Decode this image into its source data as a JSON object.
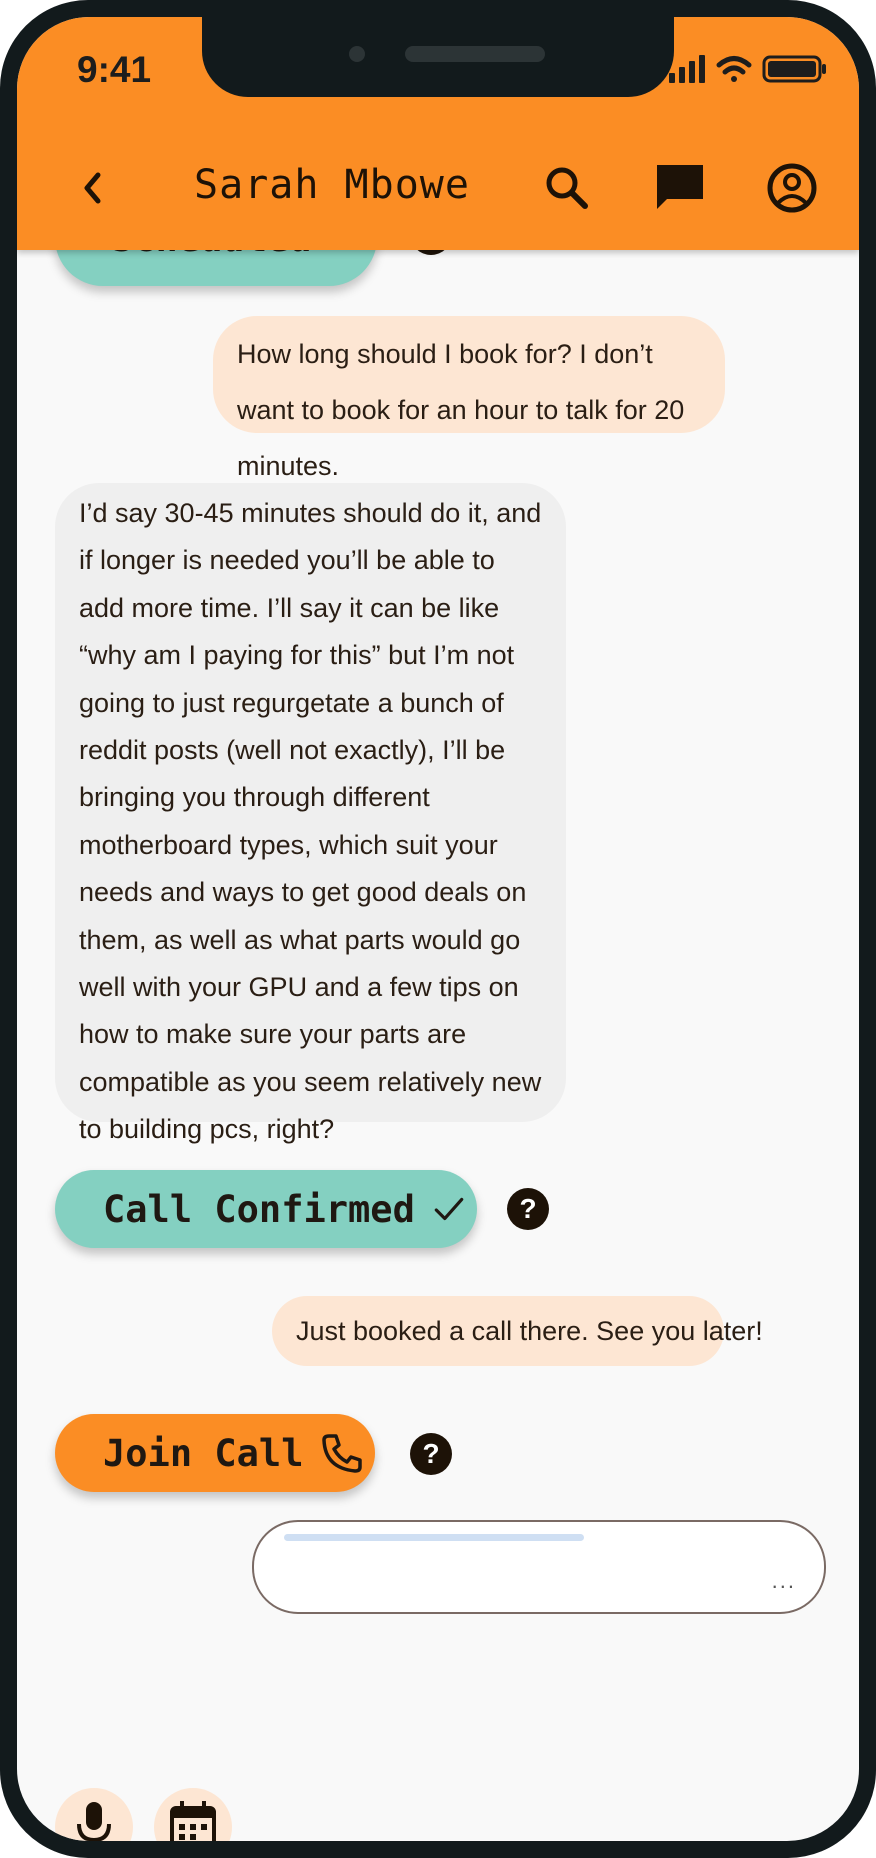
{
  "status_bar": {
    "time": "9:41"
  },
  "header": {
    "title": "Sarah Mbowe"
  },
  "messages": {
    "partial_pill": "Scheduled",
    "out_1": "How long should I book for? I don’t want to book for an hour to talk for 20 minutes.",
    "in_1": "I’d say 30-45 minutes should do it, and if longer is needed you’ll be able to add more time. I’ll say it can be like “why am I paying for this” but I’m not going to just regurgetate a bunch of reddit posts (well not exactly), I’ll be bringing you through different motherboard types, which suit your needs and ways to get good deals on them, as well as what parts would go well with your GPU and a few tips on how to make sure your parts are compatible as you seem relatively new to building pcs, right?",
    "call_confirmed": "Call Confirmed",
    "out_2": "Just booked a call there. See you later!",
    "join_call": "Join Call"
  },
  "composer": {
    "dots": "..."
  },
  "colors": {
    "primary_orange": "#fb8d24",
    "teal": "#84d0c1",
    "outgoing_bubble": "#fde6d3",
    "incoming_bubble": "#efefef",
    "text_dark": "#2a1e14"
  },
  "icons": [
    "back-chevron-icon",
    "search-icon",
    "chat-icon",
    "account-icon",
    "check-icon",
    "help-icon",
    "phone-icon",
    "microphone-icon",
    "calendar-icon"
  ]
}
